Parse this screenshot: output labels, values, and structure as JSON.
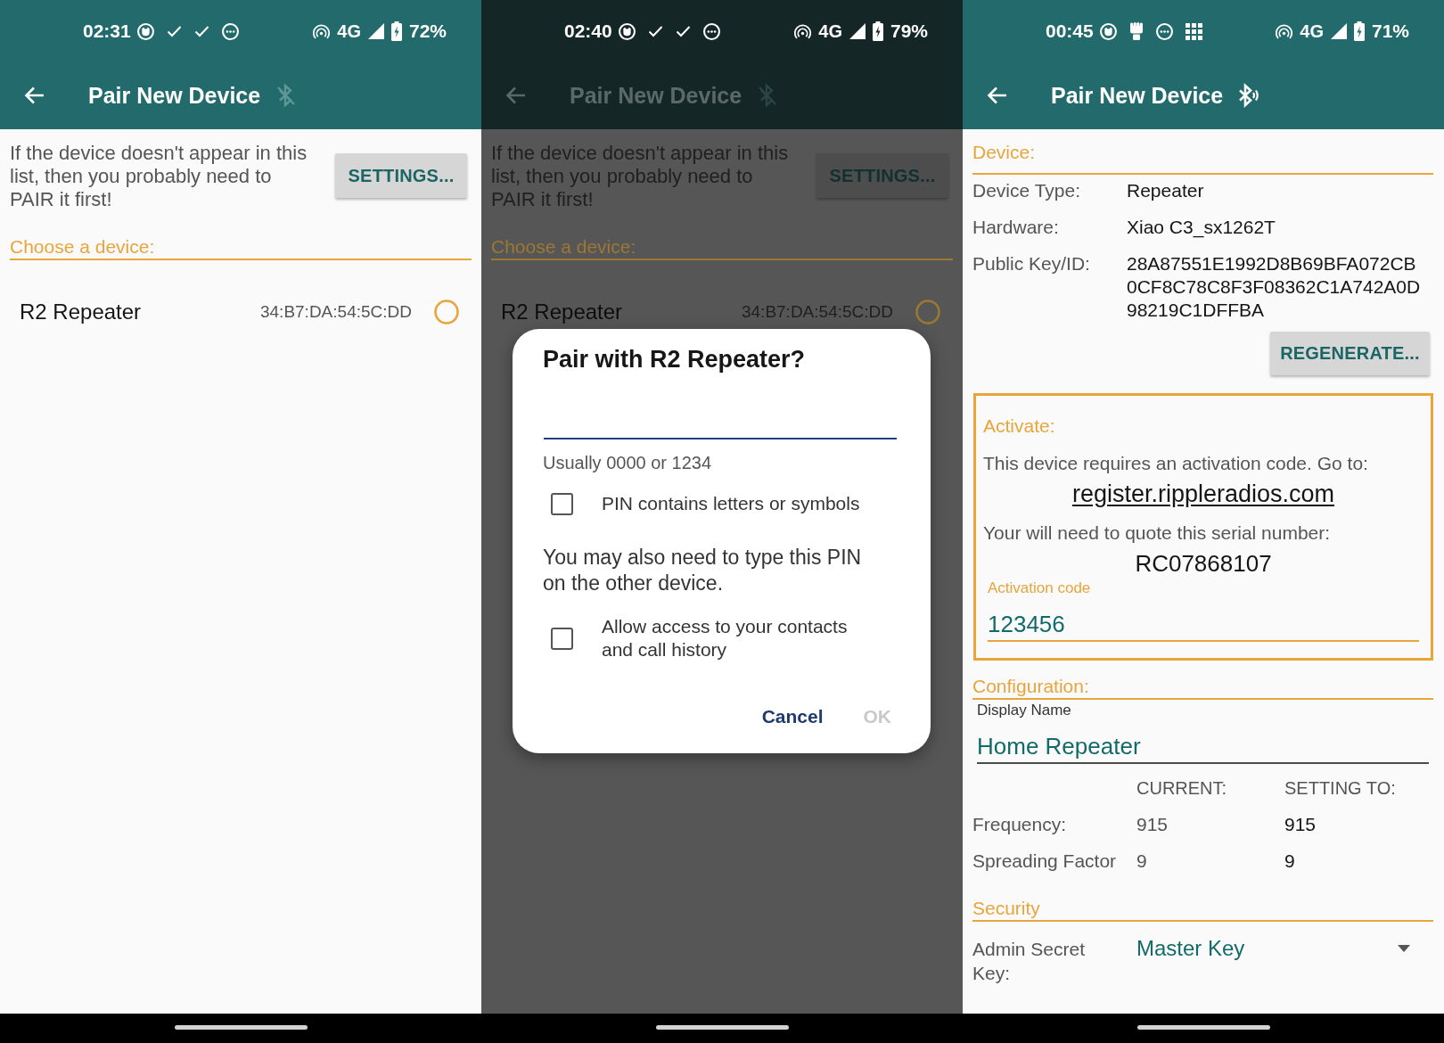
{
  "screens": [
    {
      "kind": "device_list",
      "dimmed": false,
      "status_bar": {
        "time": "02:31",
        "notifications": [
          {
            "kind": "face"
          },
          {
            "kind": "check"
          },
          {
            "kind": "check"
          },
          {
            "kind": "dots"
          }
        ],
        "network": "4G",
        "battery": "72%"
      },
      "app_bar": {
        "title": "Pair New Device",
        "bluetooth_connected": false
      },
      "intro": "If the device doesn't appear in this list, then you probably need to PAIR it first!",
      "settings_button": "SETTINGS...",
      "section_title": "Choose a device:",
      "devices": [
        {
          "name": "R2 Repeater",
          "address": "34:B7:DA:54:5C:DD",
          "selected": false
        }
      ]
    },
    {
      "kind": "device_list",
      "dimmed": true,
      "status_bar": {
        "time": "02:40",
        "notifications": [
          {
            "kind": "face"
          },
          {
            "kind": "check"
          },
          {
            "kind": "check"
          },
          {
            "kind": "dots"
          }
        ],
        "network": "4G",
        "battery": "79%"
      },
      "app_bar": {
        "title": "Pair New Device",
        "bluetooth_connected": false
      },
      "intro": "If the device doesn't appear in this list, then you probably need to PAIR it first!",
      "settings_button": "SETTINGS...",
      "section_title": "Choose a device:",
      "devices": [
        {
          "name": "R2 Repeater",
          "address": "34:B7:DA:54:5C:DD",
          "selected": false
        }
      ],
      "dialog": {
        "title": "Pair with R2 Repeater?",
        "pin_field": {
          "helper": "Usually 0000 or 1234"
        },
        "items": [
          {
            "kind": "checkbox",
            "label": "PIN contains letters or symbols",
            "checked": false
          },
          {
            "kind": "note",
            "text": "You may also need to type this PIN on the other device."
          },
          {
            "kind": "checkbox",
            "label": "Allow access to your contacts and call history",
            "checked": false
          }
        ],
        "buttons": [
          {
            "label": "Cancel",
            "disabled": false
          },
          {
            "label": "OK",
            "disabled": true
          }
        ]
      }
    },
    {
      "kind": "device_setup",
      "dimmed": false,
      "status_bar": {
        "time": "00:45",
        "notifications": [
          {
            "kind": "face"
          },
          {
            "kind": "fist"
          },
          {
            "kind": "dots"
          },
          {
            "kind": "grid"
          }
        ],
        "network": "4G",
        "battery": "71%"
      },
      "app_bar": {
        "title": "Pair New Device",
        "bluetooth_connected": true
      },
      "device": {
        "title": "Device:",
        "fields": [
          {
            "label": "Device Type:",
            "value": "Repeater"
          },
          {
            "label": "Hardware:",
            "value": "Xiao C3_sx1262T"
          },
          {
            "label": "Public Key/ID:",
            "value": "28A87551E1992D8B69BFA072CB0CF8C78C8F3F08362C1A742A0D98219C1DFFBA"
          }
        ],
        "button": "REGENERATE..."
      },
      "activate": {
        "title": "Activate:",
        "instruction": "This device requires an activation code. Go to:",
        "link": "register.rippleradios.com",
        "serial_prompt": "Your will need to quote this serial number:",
        "serial": "RC07868107",
        "code_field": {
          "label": "Activation code",
          "value": "123456"
        }
      },
      "configuration": {
        "title": "Configuration:",
        "name_field": {
          "label": "Display Name",
          "value": "Home Repeater"
        },
        "columns": [
          "CURRENT:",
          "SETTING TO:"
        ],
        "rows": [
          {
            "label": "Frequency:",
            "current": "915",
            "setting": "915"
          },
          {
            "label": "Spreading Factor",
            "current": "9",
            "setting": "9"
          }
        ]
      },
      "security": {
        "title": "Security",
        "admin_key": {
          "label": "Admin Secret Key:",
          "value": "Master Key"
        }
      }
    }
  ]
}
